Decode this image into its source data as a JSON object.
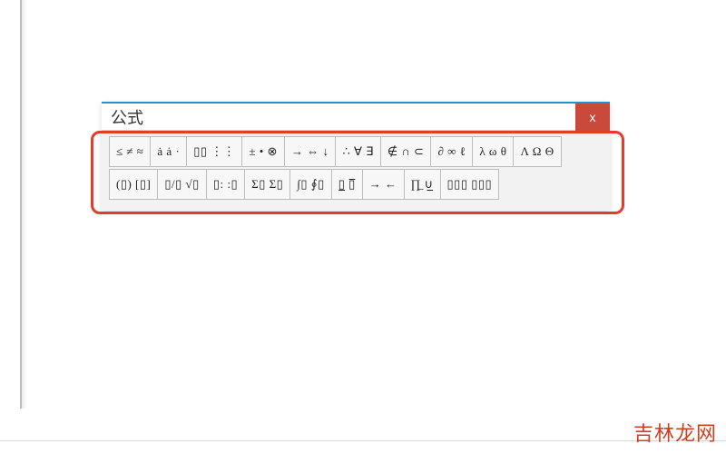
{
  "dialog": {
    "title": "公式",
    "close_label": "x"
  },
  "toolbar": {
    "row1": [
      {
        "name": "relational-symbols",
        "label": "≤ ≠ ≈"
      },
      {
        "name": "embellishments",
        "label": "a͏̇ ȧ͏ ·"
      },
      {
        "name": "spaces-ellipses",
        "label": "▯▯ ⋮⋮"
      },
      {
        "name": "operator-symbols",
        "label": "± • ⊗"
      },
      {
        "name": "arrow-symbols",
        "label": "→ ⇔ ↓"
      },
      {
        "name": "logical-symbols",
        "label": "∴ ∀ ∃"
      },
      {
        "name": "set-theory-symbols",
        "label": "∉ ∩ ⊂"
      },
      {
        "name": "misc-symbols",
        "label": "∂ ∞ ℓ"
      },
      {
        "name": "lowercase-greek",
        "label": "λ ω θ"
      },
      {
        "name": "uppercase-greek",
        "label": "Λ Ω Θ"
      }
    ],
    "row2": [
      {
        "name": "fence-templates",
        "label": "(▯) [▯]"
      },
      {
        "name": "fraction-radical",
        "label": "▯/▯ √▯"
      },
      {
        "name": "subscript-superscript",
        "label": "▯: :▯"
      },
      {
        "name": "summation-templates",
        "label": "Σ▯ Σ▯"
      },
      {
        "name": "integral-templates",
        "label": "∫▯ ∮▯"
      },
      {
        "name": "underbar-overbar",
        "label": "▯̲ ▯̅"
      },
      {
        "name": "labeled-arrows",
        "label": "→ ←"
      },
      {
        "name": "products-set",
        "label": "∏̲ ∪̲"
      },
      {
        "name": "matrix-templates",
        "label": "▯▯▯ ▯▯▯"
      }
    ]
  },
  "watermark": "吉林龙网"
}
